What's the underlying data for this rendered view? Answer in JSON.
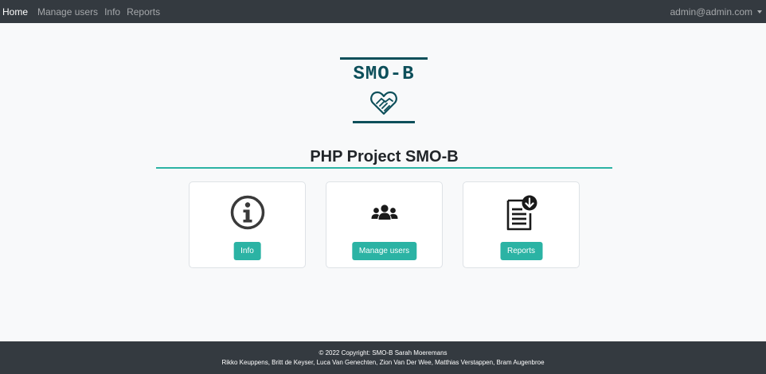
{
  "navbar": {
    "brand": "Home",
    "links": [
      "Manage users",
      "Info",
      "Reports"
    ],
    "user": "admin@admin.com"
  },
  "logo": {
    "text": "SMO-B",
    "icon": "handshake-heart-icon"
  },
  "main": {
    "title": "PHP Project SMO-B",
    "cards": [
      {
        "icon": "info-icon",
        "button": "Info"
      },
      {
        "icon": "users-group-icon",
        "button": "Manage users"
      },
      {
        "icon": "report-download-icon",
        "button": "Reports"
      }
    ]
  },
  "footer": {
    "copyright": "© 2022 Copyright: SMO-B Sarah Moeremans",
    "authors": "Rikko Keuppens, Britt de Keyser, Luca Van Genechten, Zion Van Der Wee, Matthias Verstappen, Bram Augenbroe"
  },
  "colors": {
    "navbar": "#343a40",
    "accent": "#2bb3a4",
    "logo": "#0d4f5a",
    "background": "#f8f9fa"
  }
}
